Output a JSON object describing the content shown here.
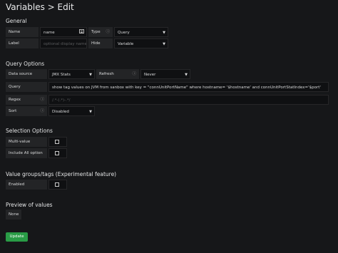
{
  "page": {
    "title": "Variables > Edit"
  },
  "general": {
    "heading": "General",
    "name_label": "Name",
    "name_value": "name",
    "type_label": "Type",
    "type_value": "Query",
    "label_label": "Label",
    "label_placeholder": "optional display name",
    "hide_label": "Hide",
    "hide_value": "Variable"
  },
  "query_options": {
    "heading": "Query Options",
    "datasource_label": "Data source",
    "datasource_value": "JMX Stats",
    "refresh_label": "Refresh",
    "refresh_value": "Never",
    "query_label": "Query",
    "query_value": "show tag values on JVM from sanbox with key = \"connUnitPortName\"  where hostname= '$hostname'  and connUnitPortStatIndex='$port'",
    "regex_label": "Regex",
    "regex_placeholder": "/.*-(.*)-.*/",
    "sort_label": "Sort",
    "sort_value": "Disabled"
  },
  "selection_options": {
    "heading": "Selection Options",
    "multi_label": "Multi-value",
    "multi_checked": false,
    "all_label": "Include All option",
    "all_checked": false
  },
  "value_groups": {
    "heading": "Value groups/tags (Experimental feature)",
    "enabled_label": "Enabled",
    "enabled_checked": false
  },
  "preview": {
    "heading": "Preview of values",
    "none_label": "None"
  },
  "actions": {
    "update_label": "Update"
  },
  "colors": {
    "background": "#161719",
    "label_bg": "#232426",
    "input_bg": "#0f1012",
    "primary_button": "#299c46"
  },
  "icons": {
    "info": "info-circle-icon",
    "dropdown": "caret-down-icon",
    "name_field": "id-card-icon"
  }
}
